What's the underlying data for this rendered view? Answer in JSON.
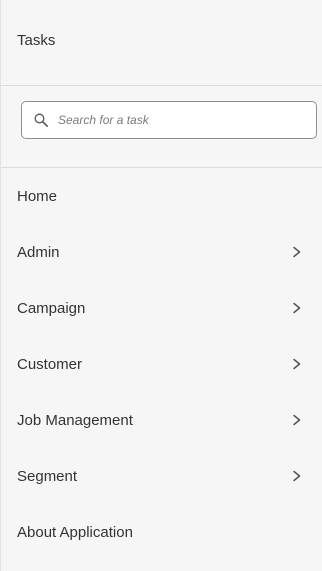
{
  "panel": {
    "title": "Tasks"
  },
  "search": {
    "placeholder": "Search for a task",
    "icon": "search-icon"
  },
  "menu": {
    "items": [
      {
        "label": "Home",
        "has_submenu": false
      },
      {
        "label": "Admin",
        "has_submenu": true,
        "icon": "chevron-right-icon"
      },
      {
        "label": "Campaign",
        "has_submenu": true,
        "icon": "chevron-right-icon"
      },
      {
        "label": "Customer",
        "has_submenu": true,
        "icon": "chevron-right-icon"
      },
      {
        "label": "Job Management",
        "has_submenu": true,
        "icon": "chevron-right-icon"
      },
      {
        "label": "Segment",
        "has_submenu": true,
        "icon": "chevron-right-icon"
      },
      {
        "label": "About Application",
        "has_submenu": false
      }
    ]
  },
  "colors": {
    "panel_bg": "#f6f6f6",
    "divider": "#dcdcdc",
    "text": "#333333",
    "input_border": "#8f8f8f"
  }
}
